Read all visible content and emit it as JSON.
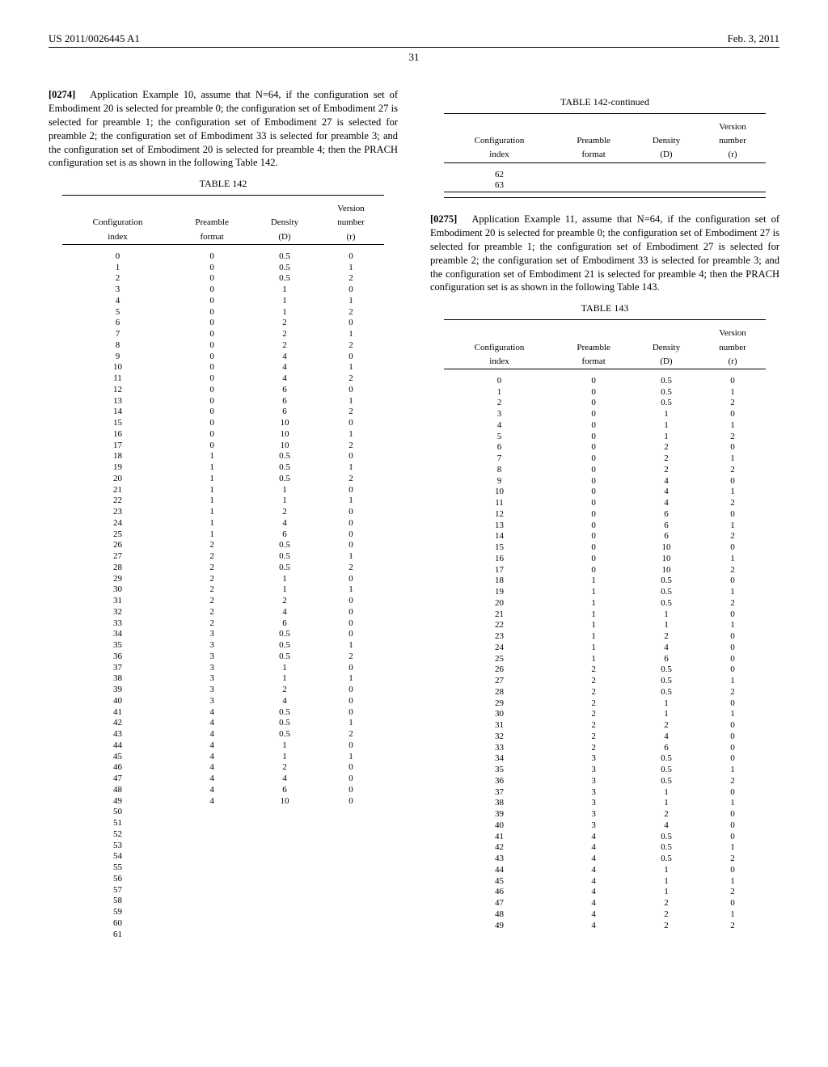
{
  "header": {
    "pub_number": "US 2011/0026445 A1",
    "pub_date": "Feb. 3, 2011",
    "page": "31"
  },
  "left": {
    "para_num": "[0274]",
    "para_text": "Application Example 10, assume that N=64, if the configuration set of Embodiment 20 is selected for preamble 0; the configuration set of Embodiment 27 is selected for preamble 1; the configuration set of Embodiment 27 is selected for preamble 2; the configuration set of Embodiment 33 is selected for preamble 3; and the configuration set of Embodiment 20 is selected for preamble 4; then the PRACH configuration set is as shown in the following Table 142.",
    "table_title": "TABLE 142",
    "headers": {
      "c1a": "Configuration",
      "c1b": "index",
      "c2a": "Preamble",
      "c2b": "format",
      "c3a": "Density",
      "c3b": "(D)",
      "c4a": "Version",
      "c4b": "number",
      "c4c": "(r)"
    },
    "rows": [
      [
        "0",
        "0",
        "0.5",
        "0"
      ],
      [
        "1",
        "0",
        "0.5",
        "1"
      ],
      [
        "2",
        "0",
        "0.5",
        "2"
      ],
      [
        "3",
        "0",
        "1",
        "0"
      ],
      [
        "4",
        "0",
        "1",
        "1"
      ],
      [
        "5",
        "0",
        "1",
        "2"
      ],
      [
        "6",
        "0",
        "2",
        "0"
      ],
      [
        "7",
        "0",
        "2",
        "1"
      ],
      [
        "8",
        "0",
        "2",
        "2"
      ],
      [
        "9",
        "0",
        "4",
        "0"
      ],
      [
        "10",
        "0",
        "4",
        "1"
      ],
      [
        "11",
        "0",
        "4",
        "2"
      ],
      [
        "12",
        "0",
        "6",
        "0"
      ],
      [
        "13",
        "0",
        "6",
        "1"
      ],
      [
        "14",
        "0",
        "6",
        "2"
      ],
      [
        "15",
        "0",
        "10",
        "0"
      ],
      [
        "16",
        "0",
        "10",
        "1"
      ],
      [
        "17",
        "0",
        "10",
        "2"
      ],
      [
        "18",
        "1",
        "0.5",
        "0"
      ],
      [
        "19",
        "1",
        "0.5",
        "1"
      ],
      [
        "20",
        "1",
        "0.5",
        "2"
      ],
      [
        "21",
        "1",
        "1",
        "0"
      ],
      [
        "22",
        "1",
        "1",
        "1"
      ],
      [
        "23",
        "1",
        "2",
        "0"
      ],
      [
        "24",
        "1",
        "4",
        "0"
      ],
      [
        "25",
        "1",
        "6",
        "0"
      ],
      [
        "26",
        "2",
        "0.5",
        "0"
      ],
      [
        "27",
        "2",
        "0.5",
        "1"
      ],
      [
        "28",
        "2",
        "0.5",
        "2"
      ],
      [
        "29",
        "2",
        "1",
        "0"
      ],
      [
        "30",
        "2",
        "1",
        "1"
      ],
      [
        "31",
        "2",
        "2",
        "0"
      ],
      [
        "32",
        "2",
        "4",
        "0"
      ],
      [
        "33",
        "2",
        "6",
        "0"
      ],
      [
        "34",
        "3",
        "0.5",
        "0"
      ],
      [
        "35",
        "3",
        "0.5",
        "1"
      ],
      [
        "36",
        "3",
        "0.5",
        "2"
      ],
      [
        "37",
        "3",
        "1",
        "0"
      ],
      [
        "38",
        "3",
        "1",
        "1"
      ],
      [
        "39",
        "3",
        "2",
        "0"
      ],
      [
        "40",
        "3",
        "4",
        "0"
      ],
      [
        "41",
        "4",
        "0.5",
        "0"
      ],
      [
        "42",
        "4",
        "0.5",
        "1"
      ],
      [
        "43",
        "4",
        "0.5",
        "2"
      ],
      [
        "44",
        "4",
        "1",
        "0"
      ],
      [
        "45",
        "4",
        "1",
        "1"
      ],
      [
        "46",
        "4",
        "2",
        "0"
      ],
      [
        "47",
        "4",
        "4",
        "0"
      ],
      [
        "48",
        "4",
        "6",
        "0"
      ],
      [
        "49",
        "4",
        "10",
        "0"
      ],
      [
        "50",
        "",
        "",
        ""
      ],
      [
        "51",
        "",
        "",
        ""
      ],
      [
        "52",
        "",
        "",
        ""
      ],
      [
        "53",
        "",
        "",
        ""
      ],
      [
        "54",
        "",
        "",
        ""
      ],
      [
        "55",
        "",
        "",
        ""
      ],
      [
        "56",
        "",
        "",
        ""
      ],
      [
        "57",
        "",
        "",
        ""
      ],
      [
        "58",
        "",
        "",
        ""
      ],
      [
        "59",
        "",
        "",
        ""
      ],
      [
        "60",
        "",
        "",
        ""
      ],
      [
        "61",
        "",
        "",
        ""
      ]
    ]
  },
  "right": {
    "cont_title": "TABLE 142-continued",
    "cont_headers": {
      "c1a": "Configuration",
      "c1b": "index",
      "c2a": "Preamble",
      "c2b": "format",
      "c3a": "Density",
      "c3b": "(D)",
      "c4a": "Version",
      "c4b": "number",
      "c4c": "(r)"
    },
    "cont_rows": [
      [
        "62",
        "",
        "",
        ""
      ],
      [
        "63",
        "",
        "",
        ""
      ]
    ],
    "para_num": "[0275]",
    "para_text": "Application Example 11, assume that N=64, if the configuration set of Embodiment 20 is selected for preamble 0; the configuration set of Embodiment 27 is selected for preamble 1; the configuration set of Embodiment 27 is selected for preamble 2; the configuration set of Embodiment 33 is selected for preamble 3; and the configuration set of Embodiment 21 is selected for preamble 4; then the PRACH configuration set is as shown in the following Table 143.",
    "table_title": "TABLE 143",
    "headers": {
      "c1a": "Configuration",
      "c1b": "index",
      "c2a": "Preamble",
      "c2b": "format",
      "c3a": "Density",
      "c3b": "(D)",
      "c4a": "Version",
      "c4b": "number",
      "c4c": "(r)"
    },
    "rows": [
      [
        "0",
        "0",
        "0.5",
        "0"
      ],
      [
        "1",
        "0",
        "0.5",
        "1"
      ],
      [
        "2",
        "0",
        "0.5",
        "2"
      ],
      [
        "3",
        "0",
        "1",
        "0"
      ],
      [
        "4",
        "0",
        "1",
        "1"
      ],
      [
        "5",
        "0",
        "1",
        "2"
      ],
      [
        "6",
        "0",
        "2",
        "0"
      ],
      [
        "7",
        "0",
        "2",
        "1"
      ],
      [
        "8",
        "0",
        "2",
        "2"
      ],
      [
        "9",
        "0",
        "4",
        "0"
      ],
      [
        "10",
        "0",
        "4",
        "1"
      ],
      [
        "11",
        "0",
        "4",
        "2"
      ],
      [
        "12",
        "0",
        "6",
        "0"
      ],
      [
        "13",
        "0",
        "6",
        "1"
      ],
      [
        "14",
        "0",
        "6",
        "2"
      ],
      [
        "15",
        "0",
        "10",
        "0"
      ],
      [
        "16",
        "0",
        "10",
        "1"
      ],
      [
        "17",
        "0",
        "10",
        "2"
      ],
      [
        "18",
        "1",
        "0.5",
        "0"
      ],
      [
        "19",
        "1",
        "0.5",
        "1"
      ],
      [
        "20",
        "1",
        "0.5",
        "2"
      ],
      [
        "21",
        "1",
        "1",
        "0"
      ],
      [
        "22",
        "1",
        "1",
        "1"
      ],
      [
        "23",
        "1",
        "2",
        "0"
      ],
      [
        "24",
        "1",
        "4",
        "0"
      ],
      [
        "25",
        "1",
        "6",
        "0"
      ],
      [
        "26",
        "2",
        "0.5",
        "0"
      ],
      [
        "27",
        "2",
        "0.5",
        "1"
      ],
      [
        "28",
        "2",
        "0.5",
        "2"
      ],
      [
        "29",
        "2",
        "1",
        "0"
      ],
      [
        "30",
        "2",
        "1",
        "1"
      ],
      [
        "31",
        "2",
        "2",
        "0"
      ],
      [
        "32",
        "2",
        "4",
        "0"
      ],
      [
        "33",
        "2",
        "6",
        "0"
      ],
      [
        "34",
        "3",
        "0.5",
        "0"
      ],
      [
        "35",
        "3",
        "0.5",
        "1"
      ],
      [
        "36",
        "3",
        "0.5",
        "2"
      ],
      [
        "37",
        "3",
        "1",
        "0"
      ],
      [
        "38",
        "3",
        "1",
        "1"
      ],
      [
        "39",
        "3",
        "2",
        "0"
      ],
      [
        "40",
        "3",
        "4",
        "0"
      ],
      [
        "41",
        "4",
        "0.5",
        "0"
      ],
      [
        "42",
        "4",
        "0.5",
        "1"
      ],
      [
        "43",
        "4",
        "0.5",
        "2"
      ],
      [
        "44",
        "4",
        "1",
        "0"
      ],
      [
        "45",
        "4",
        "1",
        "1"
      ],
      [
        "46",
        "4",
        "1",
        "2"
      ],
      [
        "47",
        "4",
        "2",
        "0"
      ],
      [
        "48",
        "4",
        "2",
        "1"
      ],
      [
        "49",
        "4",
        "2",
        "2"
      ]
    ]
  }
}
